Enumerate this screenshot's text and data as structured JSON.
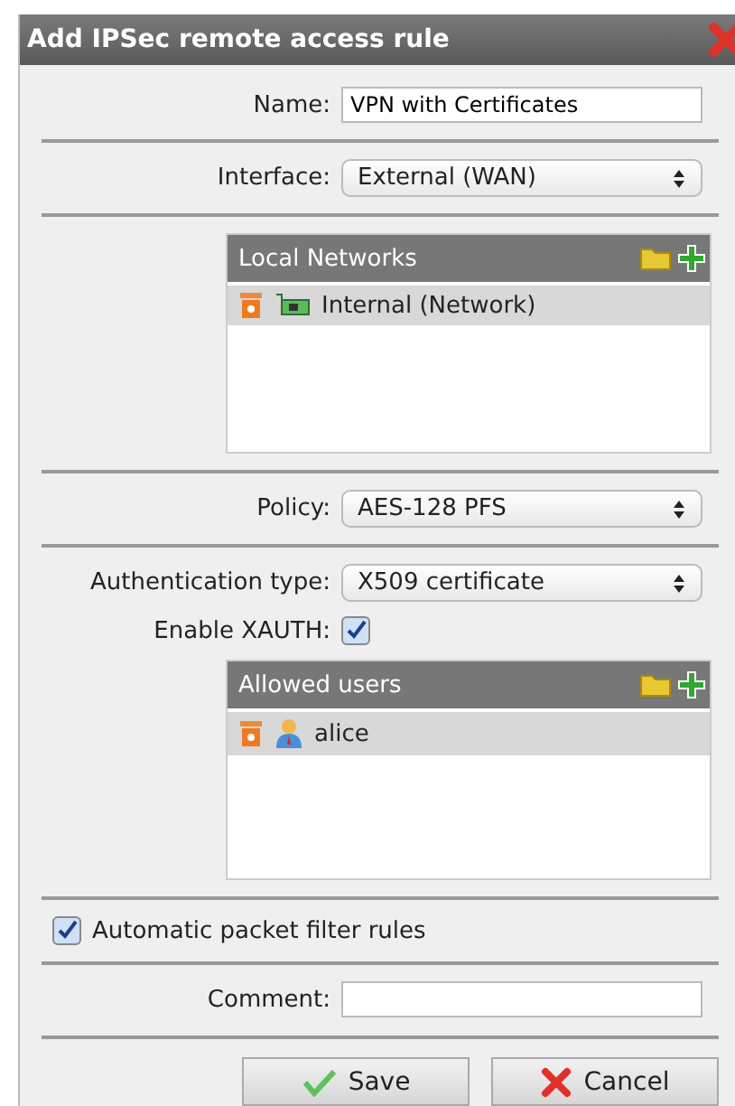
{
  "window": {
    "title": "Add IPSec remote access rule"
  },
  "sections": [
    [
      {
        "kind": "text",
        "label": "Name:",
        "value": "VPN with Certificates"
      }
    ],
    [
      {
        "kind": "select",
        "label": "Interface:",
        "value": "External (WAN)"
      }
    ],
    [
      {
        "kind": "list",
        "title": "Local Networks",
        "items": [
          {
            "kind": "network",
            "label": "Internal (Network)",
            "selected": true
          }
        ]
      }
    ],
    [
      {
        "kind": "select",
        "label": "Policy:",
        "value": "AES-128 PFS"
      }
    ],
    [
      {
        "kind": "select",
        "label": "Authentication type:",
        "value": "X509 certificate"
      },
      {
        "kind": "check",
        "label": "Enable XAUTH:",
        "checked": true
      },
      {
        "kind": "list",
        "title": "Allowed users",
        "items": [
          {
            "kind": "user",
            "label": "alice",
            "selected": true
          }
        ]
      }
    ],
    [
      {
        "kind": "check_left",
        "label": "Automatic packet filter rules",
        "checked": true
      }
    ],
    [
      {
        "kind": "text",
        "label": "Comment:"
      }
    ]
  ],
  "buttons": [
    {
      "kind": "save",
      "label": "Save"
    },
    {
      "kind": "cancel",
      "label": "Cancel"
    }
  ]
}
